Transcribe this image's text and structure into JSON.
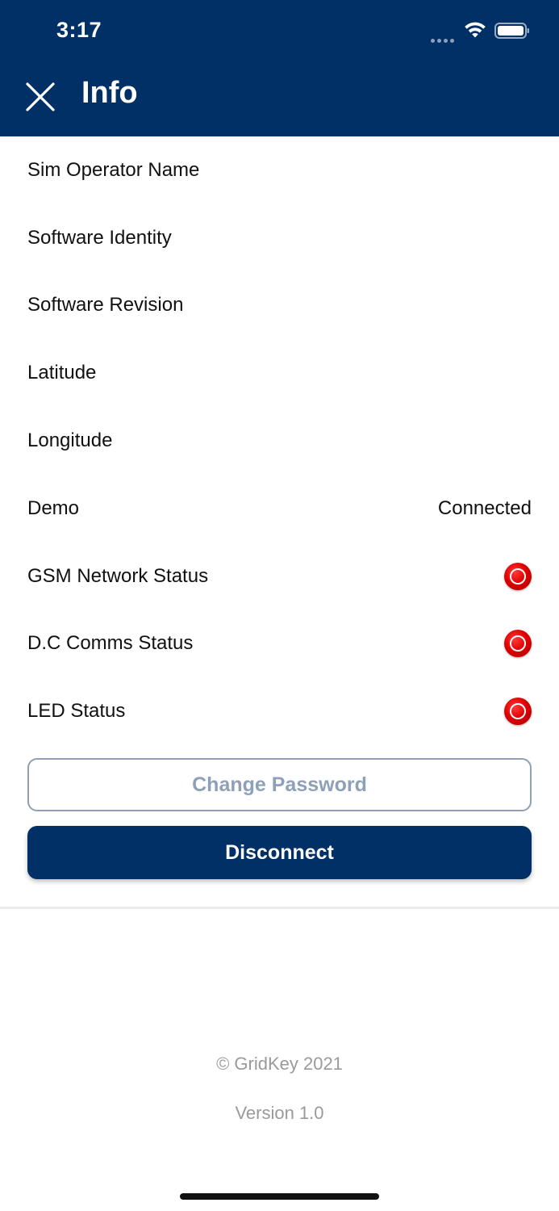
{
  "status_bar": {
    "time": "3:17"
  },
  "header": {
    "title": "Info",
    "close_icon": "close-icon",
    "background_color": "#013066"
  },
  "rows": [
    {
      "label": "Sim Operator Name",
      "value": ""
    },
    {
      "label": "Software Identity",
      "value": ""
    },
    {
      "label": "Software Revision",
      "value": ""
    },
    {
      "label": "Latitude",
      "value": ""
    },
    {
      "label": "Longitude",
      "value": ""
    },
    {
      "label": "Demo",
      "value": "Connected"
    },
    {
      "label": "GSM Network Status",
      "indicator": "red-status-icon"
    },
    {
      "label": "D.C Comms Status",
      "indicator": "red-status-icon"
    },
    {
      "label": "LED Status",
      "indicator": "red-status-icon"
    }
  ],
  "buttons": {
    "change_password": "Change Password",
    "disconnect": "Disconnect"
  },
  "footer": {
    "copyright": "© GridKey 2021",
    "version": "Version 1.0"
  },
  "colors": {
    "primary": "#013066",
    "status_red": "#e00000",
    "muted_text": "#9a9a9a",
    "outline_button": "#8ea0b8"
  }
}
